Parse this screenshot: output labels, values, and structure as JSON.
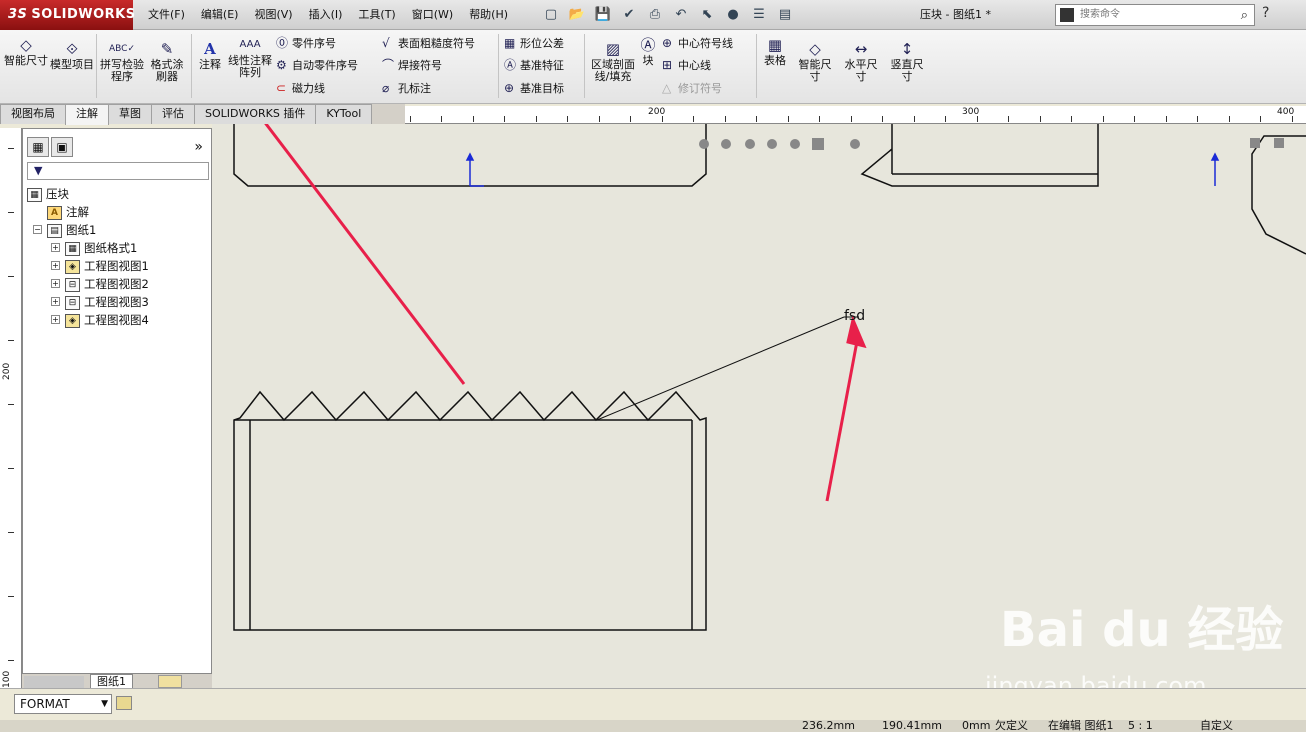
{
  "app": {
    "brand": "SOLIDWORKS",
    "brand_prefix": "3S",
    "doc_title": "压块 - 图纸1 *"
  },
  "menu": [
    "文件(F)",
    "编辑(E)",
    "视图(V)",
    "插入(I)",
    "工具(T)",
    "窗口(W)",
    "帮助(H)"
  ],
  "search": {
    "placeholder": "搜索命令"
  },
  "ribbon": {
    "smart_dim": "智能尺寸",
    "model_items": "模型项目",
    "spell_check": "拼写检验程序",
    "format_painter": "格式涂刷器",
    "note": "注释",
    "linear_note": "线性注释阵列",
    "balloon": "零件序号",
    "auto_balloon": "自动零件序号",
    "magnetic_line": "磁力线",
    "surface_finish": "表面粗糙度符号",
    "weld_symbol": "焊接符号",
    "hole_callout": "孔标注",
    "gtol": "形位公差",
    "datum_feature": "基准特征",
    "datum_target": "基准目标",
    "area_hatch": "区域剖面线/填充",
    "block": "块",
    "center_mark": "中心符号线",
    "centerline": "中心线",
    "revision_symbol": "修订符号",
    "table": "表格",
    "smart_dim2": "智能尺寸",
    "horiz_dim": "水平尺寸",
    "vert_dim": "竖直尺寸"
  },
  "tabs": [
    "视图布局",
    "注解",
    "草图",
    "评估",
    "SOLIDWORKS 插件",
    "KYTool"
  ],
  "active_tab": "注解",
  "ruler": {
    "h_labels": [
      "200",
      "300",
      "400"
    ],
    "v_labels": [
      "200",
      "100"
    ]
  },
  "tree": {
    "root": "压块",
    "items": [
      {
        "label": "注解",
        "indent": 1
      },
      {
        "label": "图纸1",
        "indent": 1
      },
      {
        "label": "图纸格式1",
        "indent": 2
      },
      {
        "label": "工程图视图1",
        "indent": 2
      },
      {
        "label": "工程图视图2",
        "indent": 2
      },
      {
        "label": "工程图视图3",
        "indent": 2
      },
      {
        "label": "工程图视图4",
        "indent": 2
      }
    ]
  },
  "sheet_tab": "图纸1",
  "canvas_note": "fsd",
  "format_select": "FORMAT",
  "status": {
    "x": "236.2mm",
    "y": "190.41mm",
    "z": "0mm",
    "state": "欠定义",
    "editing": "在编辑 图纸1",
    "scale": "5 : 1",
    "custom": "自定义"
  },
  "watermark": {
    "main": "Bai du 经验",
    "sub": "jingyan.baidu.com"
  },
  "colors": {
    "arrow": "#e8204a",
    "anchor_blue": "#1a2bd6",
    "canvas": "#e7e6dc"
  }
}
